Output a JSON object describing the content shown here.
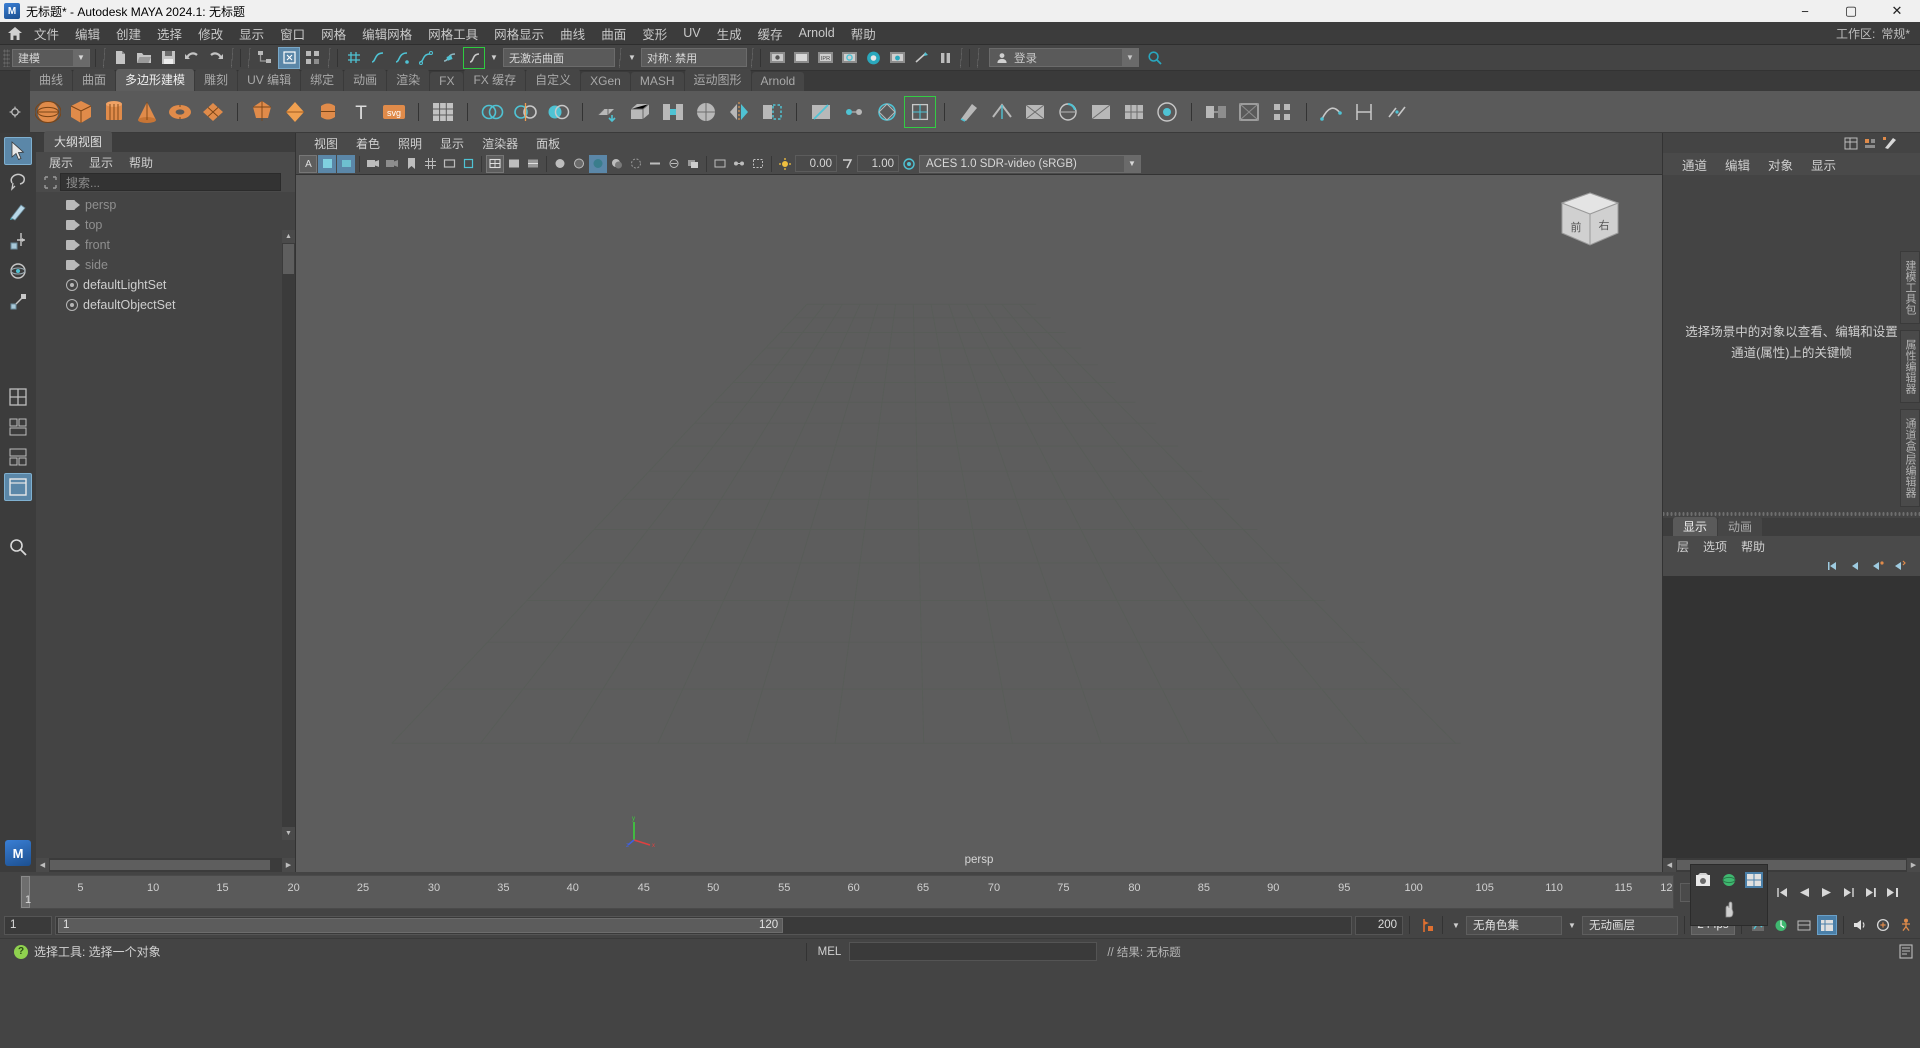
{
  "titlebar": {
    "title": "无标题* - Autodesk MAYA 2024.1: 无标题",
    "minimize": "−",
    "maximize": "▢",
    "close": "✕",
    "app_icon": "maya-logo-icon"
  },
  "menubar": {
    "home_icon": "home-icon",
    "items": [
      "文件",
      "编辑",
      "创建",
      "选择",
      "修改",
      "显示",
      "窗口",
      "网格",
      "编辑网格",
      "网格工具",
      "网格显示",
      "曲线",
      "曲面",
      "变形",
      "UV",
      "生成",
      "缓存",
      "Arnold",
      "帮助"
    ],
    "workspace_label": "工作区:",
    "workspace_value": "常规*"
  },
  "statusline": {
    "mode_select": "建模",
    "no_live_surface": "无激活曲面",
    "symmetry": "对称: 禁用",
    "login": "登录",
    "icons": [
      "new-scene-icon",
      "open-scene-icon",
      "save-scene-icon",
      "undo-icon",
      "redo-icon",
      "select-hierarchy-icon",
      "select-object-icon",
      "select-component-icon",
      "snap-grid-icon",
      "snap-curve-icon",
      "snap-point-icon",
      "snap-projected-icon",
      "snap-view-plane-icon",
      "make-live-icon",
      "render-view-icon",
      "render-region-icon",
      "ipr-render-icon",
      "render-settings-icon",
      "hypershade-icon",
      "render-sequence-icon",
      "light-tool-icon",
      "pause-icon",
      "user-icon",
      "search-help-icon"
    ]
  },
  "shelf": {
    "tabs": [
      "曲线",
      "曲面",
      "多边形建模",
      "雕刻",
      "UV 编辑",
      "绑定",
      "动画",
      "渲染",
      "FX",
      "FX 缓存",
      "自定义",
      "XGen",
      "MASH",
      "运动图形",
      "Arnold"
    ],
    "active_tab": "多边形建模",
    "tools": [
      "poly-sphere-icon",
      "poly-cube-icon",
      "poly-cylinder-icon",
      "poly-cone-icon",
      "poly-torus-icon",
      "poly-plane-icon",
      "poly-disc-icon",
      "poly-platonic-icon",
      "poly-type-icon",
      "poly-svg-icon",
      "poly-text-icon",
      "uv-editor-icon",
      "combine-icon",
      "separate-icon",
      "boolean-icon",
      "mirror-icon",
      "smooth-icon",
      "extrude-icon",
      "bevel-icon",
      "bridge-icon",
      "wedge-icon",
      "append-icon",
      "multicut-icon",
      "target-weld-icon",
      "quad-draw-icon",
      "sculpt-icon",
      "crease-icon",
      "circularize-icon",
      "spin-edge-icon",
      "poke-icon",
      "triangulate-icon",
      "quadrangulate-icon",
      "fill-hole-icon",
      "reduce-icon",
      "transfer-attr-icon",
      "soft-edge-icon",
      "hard-edge-icon",
      "curve-tool-icon",
      "measure-icon",
      "snap-align-icon"
    ]
  },
  "toolbox": {
    "tools": [
      {
        "name": "select-tool-icon",
        "label": "选择工具",
        "active": true
      },
      {
        "name": "lasso-select-icon",
        "label": "套索选择工具",
        "active": false
      },
      {
        "name": "paint-select-icon",
        "label": "绘制选择工具",
        "active": false
      },
      {
        "name": "move-tool-icon",
        "label": "移动工具",
        "active": false
      },
      {
        "name": "rotate-tool-icon",
        "label": "旋转工具",
        "active": false
      },
      {
        "name": "scale-tool-icon",
        "label": "缩放工具",
        "active": false
      },
      {
        "name": "single-pane-layout-icon",
        "label": "单视图布局",
        "active": false
      },
      {
        "name": "two-pane-layout-icon",
        "label": "双视图布局",
        "active": false
      },
      {
        "name": "three-pane-layout-icon",
        "label": "三视图布局",
        "active": false
      },
      {
        "name": "four-pane-layout-icon",
        "label": "四视图布局",
        "active": true
      },
      {
        "name": "search-icon",
        "label": "搜索",
        "active": false
      }
    ],
    "maya_badge": "MAYA"
  },
  "outliner": {
    "tab": "大纲视图",
    "menus": [
      "展示",
      "显示",
      "帮助"
    ],
    "search_placeholder": "搜索...",
    "search_icon": "filter-icon",
    "items": [
      {
        "name": "persp",
        "icon": "camera-icon",
        "type": "camera"
      },
      {
        "name": "top",
        "icon": "camera-icon",
        "type": "camera"
      },
      {
        "name": "front",
        "icon": "camera-icon",
        "type": "camera"
      },
      {
        "name": "side",
        "icon": "camera-icon",
        "type": "camera"
      },
      {
        "name": "defaultLightSet",
        "icon": "set-icon",
        "type": "set"
      },
      {
        "name": "defaultObjectSet",
        "icon": "set-icon",
        "type": "set"
      }
    ]
  },
  "viewport": {
    "menus": [
      "视图",
      "着色",
      "照明",
      "显示",
      "渲染器",
      "面板"
    ],
    "exposure": "0.00",
    "gamma": "1.00",
    "color_space": "ACES 1.0 SDR-video (sRGB)",
    "camera_label": "persp",
    "viewcube": {
      "front": "前",
      "right": "右"
    },
    "axis": {
      "x": "x",
      "y": "y",
      "z": "z"
    },
    "toolbar_icons": [
      "select-camera-icon",
      "bookmark-icon",
      "image-plane-icon",
      "camera-attr-icon",
      "grid-toggle-icon",
      "film-gate-icon",
      "resolution-gate-icon",
      "gate-mask-icon",
      "xray-icon",
      "xray-joints-icon",
      "wireframe-icon",
      "smooth-shade-icon",
      "shaded-wire-icon",
      "textured-icon",
      "lighting-icon",
      "shadows-icon",
      "ao-icon",
      "motion-blur-icon",
      "multisample-icon",
      "depth-peeling-icon",
      "isolate-select-icon",
      "exposure-icon",
      "gamma-icon",
      "color-manage-icon"
    ]
  },
  "channelbox": {
    "menus": [
      "通道",
      "编辑",
      "对象",
      "显示"
    ],
    "empty_message": "选择场景中的对象以查看、编辑和设置通道(属性)上的关键帧",
    "top_icons": [
      "channel-box-icon",
      "attribute-editor-icon",
      "modeling-toolkit-icon"
    ],
    "rail_tabs": [
      "建模工具包",
      "属性编辑器",
      "通道盒/层编辑器"
    ]
  },
  "layereditor": {
    "tabs": [
      "显示",
      "动画"
    ],
    "active_tab": "显示",
    "menus": [
      "层",
      "选项",
      "帮助"
    ],
    "icons": [
      "layer-first-icon",
      "layer-prev-icon",
      "layer-next-icon",
      "layer-new-icon"
    ]
  },
  "timeline": {
    "start_frame": "1",
    "current_frame": "1",
    "ticks": [
      "5",
      "10",
      "15",
      "20",
      "25",
      "30",
      "35",
      "40",
      "45",
      "50",
      "55",
      "60",
      "65",
      "70",
      "75",
      "80",
      "85",
      "90",
      "95",
      "100",
      "105",
      "110",
      "115",
      "12"
    ],
    "frame_field": "1",
    "playback_icons": [
      "go-to-start-icon",
      "step-back-key-icon",
      "step-back-frame-icon",
      "play-backwards-icon",
      "play-forwards-icon",
      "step-forward-frame-icon",
      "step-forward-key-icon",
      "go-to-end-icon"
    ]
  },
  "range": {
    "anim_start": "1",
    "range_start": "1",
    "range_end": "120",
    "anim_end": "200",
    "auto_key_icon": "auto-key-icon",
    "char_set": "无角色集",
    "anim_layer": "无动画层",
    "fps": "24 fps",
    "right_icons": [
      "anim-pref-icon",
      "playback-speed-icon",
      "sound-icon",
      "audio-icon",
      "skeleton-icon"
    ]
  },
  "cmdline": {
    "help_text": "选择工具: 选择一个对象",
    "mel_label": "MEL",
    "input_value": "",
    "output_text": "// 结果: 无标题",
    "ok_icon": "help-ok-icon",
    "script_editor_icon": "script-editor-icon"
  },
  "floating": {
    "icons": [
      "snapshot-icon",
      "sphere-icon",
      "grid-snap-icon",
      "hand-icon"
    ]
  },
  "colors": {
    "accent_blue": "#5b87a8",
    "shelf_orange": "#e08b4a",
    "highlight_green": "#33cc44",
    "panel_bg": "#444444",
    "viewport_bg": "#5d5d5d",
    "title_bg": "#f0f0f0"
  }
}
